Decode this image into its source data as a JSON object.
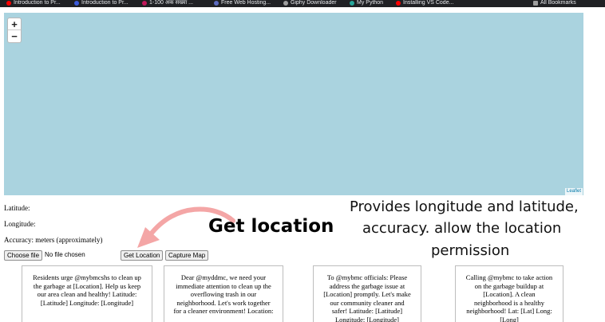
{
  "bookmarks": [
    {
      "label": "Introduction to Pr...",
      "color": "#ff0000"
    },
    {
      "label": "Introduction to Pr...",
      "color": "#3b5bdb"
    },
    {
      "label": "1-100 अंक संख्या ...",
      "color": "#c2185b"
    },
    {
      "label": "Free Web Hosting...",
      "color": "#5c6bc0"
    },
    {
      "label": "Giphy Downloader",
      "color": "#9e9e9e"
    },
    {
      "label": "My Python",
      "color": "#26a69a"
    },
    {
      "label": "Installing VS Code...",
      "color": "#ff0000"
    },
    {
      "label": "All Bookmarks",
      "color": "#9e9e9e"
    }
  ],
  "map": {
    "zoom_in": "+",
    "zoom_out": "−",
    "attribution": "Leaflet",
    "water_color": "#aad3df"
  },
  "info": {
    "latitude": "Latitude:",
    "longitude": "Longitude:",
    "accuracy": "Accuracy: meters (approximately)"
  },
  "controls": {
    "choose_file": "Choose file",
    "file_status": "No file chosen",
    "get_location": "Get Location",
    "capture_map": "Capture Map"
  },
  "annotations": {
    "title": "Get location",
    "line1": "Provides longitude and latitude,",
    "line2": "accuracy. allow the location",
    "line3": "permission",
    "arrow_color": "#f4a6a6"
  },
  "cards": [
    {
      "text": "Residents urge @mybmcshs to clean up the garbage at [Location]. Help us keep our area clean and healthy! Latitude: [Latitude] Longitude: [Longitude]"
    },
    {
      "text": "Dear @myddmc, we need your immediate attention to clean up the overflowing trash in our neighborhood. Let's work together for a cleaner environment! Location:"
    },
    {
      "text": "To @mybmc officials: Please address the garbage issue at [Location] promptly. Let's make our community cleaner and safer! Latitude: [Latitude] Longitude: [Longitude]"
    },
    {
      "text": "Calling @mybmc to take action on the garbage buildup at [Location]. A clean neighborhood is a healthy neighborhood! Lat: [Lat] Long: [Long]"
    }
  ]
}
